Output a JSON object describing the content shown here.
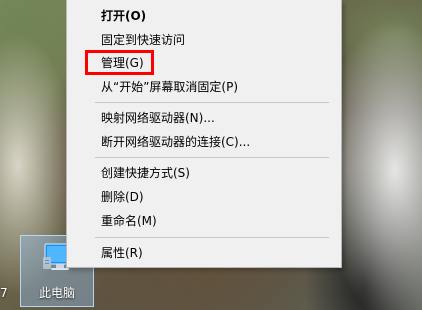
{
  "desktop": {
    "left_fragment": "7",
    "icon": {
      "label": "此电脑",
      "icon_name": "computer-monitor-icon"
    }
  },
  "context_menu": {
    "items": [
      {
        "label": "打开(O)",
        "bold": true
      },
      {
        "label": "固定到快速访问"
      },
      {
        "label": "管理(G)",
        "highlighted": true
      },
      {
        "label": "从“开始”屏幕取消固定(P)"
      },
      {
        "label": "映射网络驱动器(N)..."
      },
      {
        "label": "断开网络驱动器的连接(C)..."
      },
      {
        "label": "创建快捷方式(S)"
      },
      {
        "label": "删除(D)"
      },
      {
        "label": "重命名(M)"
      },
      {
        "label": "属性(R)"
      }
    ]
  },
  "colors": {
    "highlight": "#ff0000",
    "menu_background": "#f0f0f0",
    "selection_fill": "#96bee6"
  }
}
